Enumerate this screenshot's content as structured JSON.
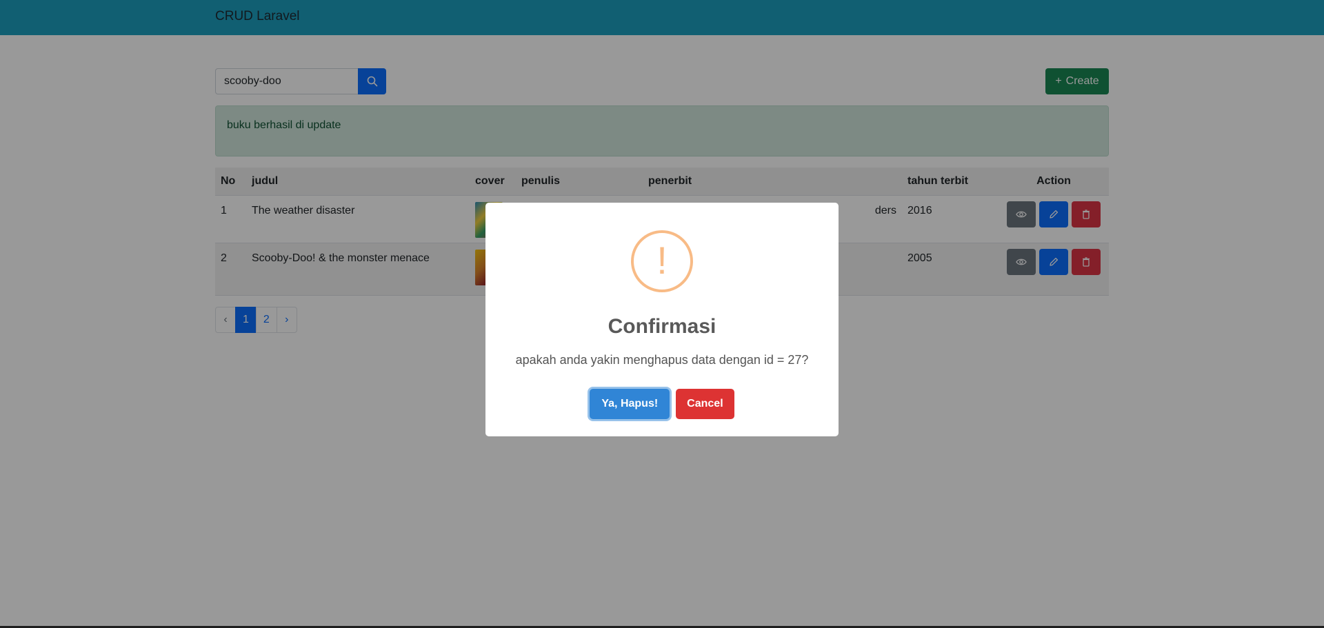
{
  "app": {
    "brand": "CRUD Laravel"
  },
  "search": {
    "value": "scooby-doo"
  },
  "toolbar": {
    "create_label": "Create",
    "create_icon": "+"
  },
  "alert": {
    "message": "buku berhasil di update"
  },
  "table": {
    "headers": [
      "No",
      "judul",
      "cover",
      "penulis",
      "penerbit",
      "tahun terbit",
      "Action"
    ],
    "rows": [
      {
        "no": "1",
        "judul": "The weather disaster",
        "penulis": "",
        "penerbit": "ders",
        "tahun": "2016"
      },
      {
        "no": "2",
        "judul": "Scooby-Doo! & the monster menace",
        "penulis": "",
        "penerbit": "",
        "tahun": "2005"
      }
    ]
  },
  "pagination": {
    "prev": "‹",
    "pages": [
      "1",
      "2"
    ],
    "next": "›",
    "active": "1"
  },
  "modal": {
    "icon": "!",
    "title": "Confirmasi",
    "text": "apakah anda yakin menghapus data dengan id = 27?",
    "confirm_label": "Ya, Hapus!",
    "cancel_label": "Cancel"
  },
  "colors": {
    "navbar": "#1d9ebf",
    "primary": "#0d6efd",
    "success": "#198754",
    "danger": "#dc3545",
    "secondary": "#6c757d",
    "warning_icon": "#f8bb86",
    "modal_confirm": "#3085d6",
    "modal_cancel": "#dd3333"
  }
}
